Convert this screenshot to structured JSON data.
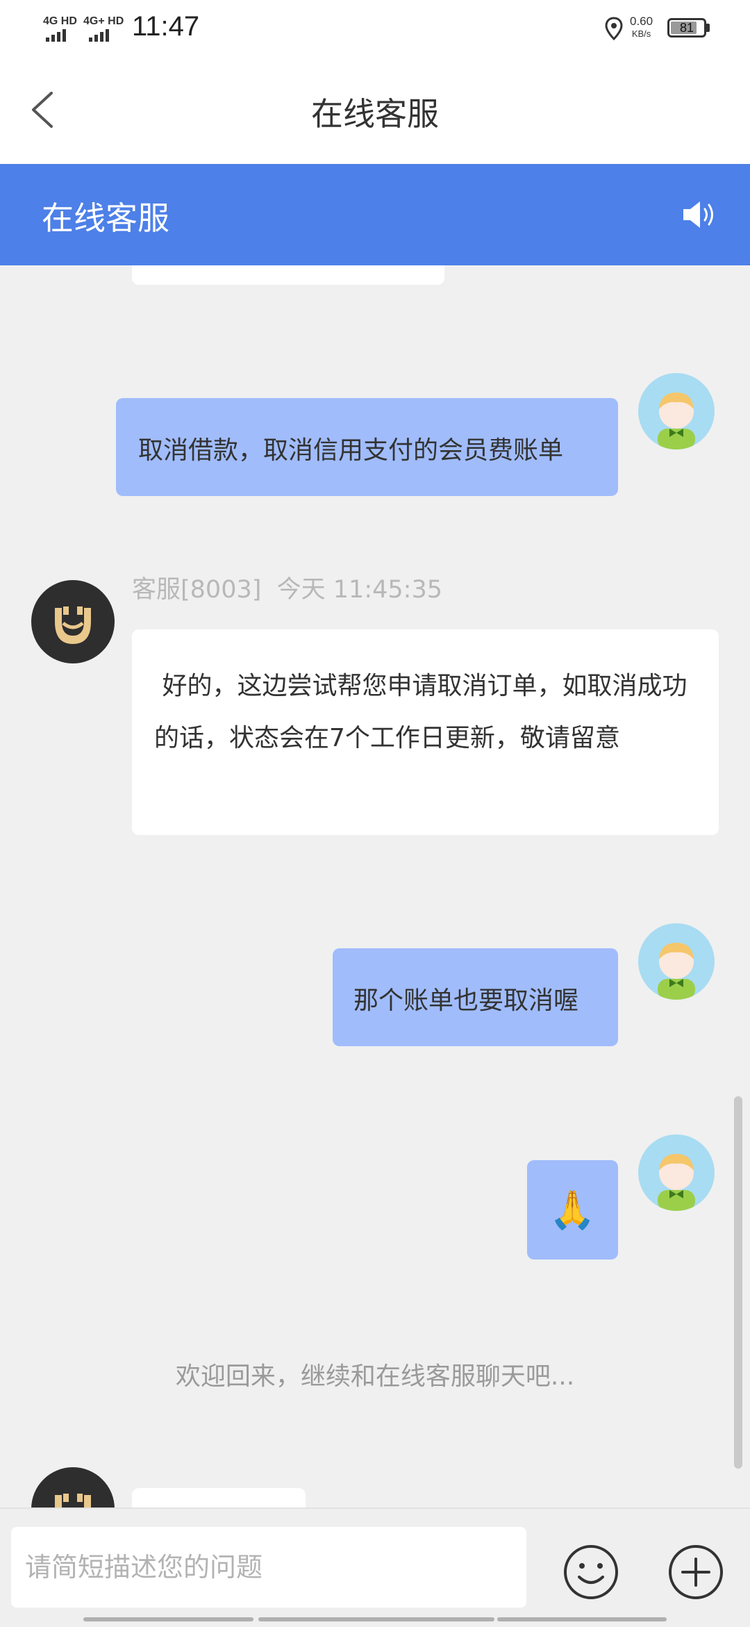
{
  "status_bar": {
    "network1": "4G HD",
    "network2": "4G+ HD",
    "time": "11:47",
    "speed_value": "0.60",
    "speed_unit": "KB/s",
    "battery": "81",
    "battery_level": 0.81
  },
  "nav": {
    "title": "在线客服",
    "back_icon": "chevron-left-icon"
  },
  "header": {
    "title": "在线客服",
    "speaker_icon": "speaker-icon"
  },
  "messages": [
    {
      "from": "user",
      "text": "取消借款，取消信用支付的会员费账单"
    },
    {
      "from": "agent",
      "sender": "客服[8003]",
      "time": "今天 11:45:35",
      "text": " 好的，这边尝试帮您申请取消订单，如取消成功的话，状态会在7个工作日更新，敬请留意"
    },
    {
      "from": "user",
      "text": "那个账单也要取消喔"
    },
    {
      "from": "user",
      "text": "🙏"
    }
  ],
  "welcome": "欢迎回来，继续和在线客服聊天吧...",
  "input": {
    "placeholder": "请简短描述您的问题",
    "value": ""
  },
  "icons": {
    "emoji": "smiley-icon",
    "plus": "plus-circle-icon"
  },
  "colors": {
    "header_blue": "#4d80e8",
    "user_bubble": "#a0bcfb",
    "page_bg": "#f0f0f0"
  }
}
